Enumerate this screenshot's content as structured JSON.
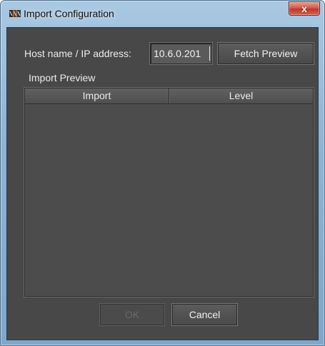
{
  "window": {
    "title": "Import Configuration",
    "close_label": "x",
    "icon": "app-logo-icon"
  },
  "form": {
    "host_label": "Host name / IP address:",
    "host_value": "10.6.0.201",
    "fetch_label": "Fetch Preview"
  },
  "preview": {
    "label": "Import Preview",
    "columns": [
      "Import",
      "Level"
    ],
    "rows": []
  },
  "actions": {
    "ok_label": "OK",
    "ok_enabled": false,
    "cancel_label": "Cancel"
  },
  "colors": {
    "client_bg": "#484848",
    "frame": "#8fb4d4",
    "close": "#c0362a"
  }
}
